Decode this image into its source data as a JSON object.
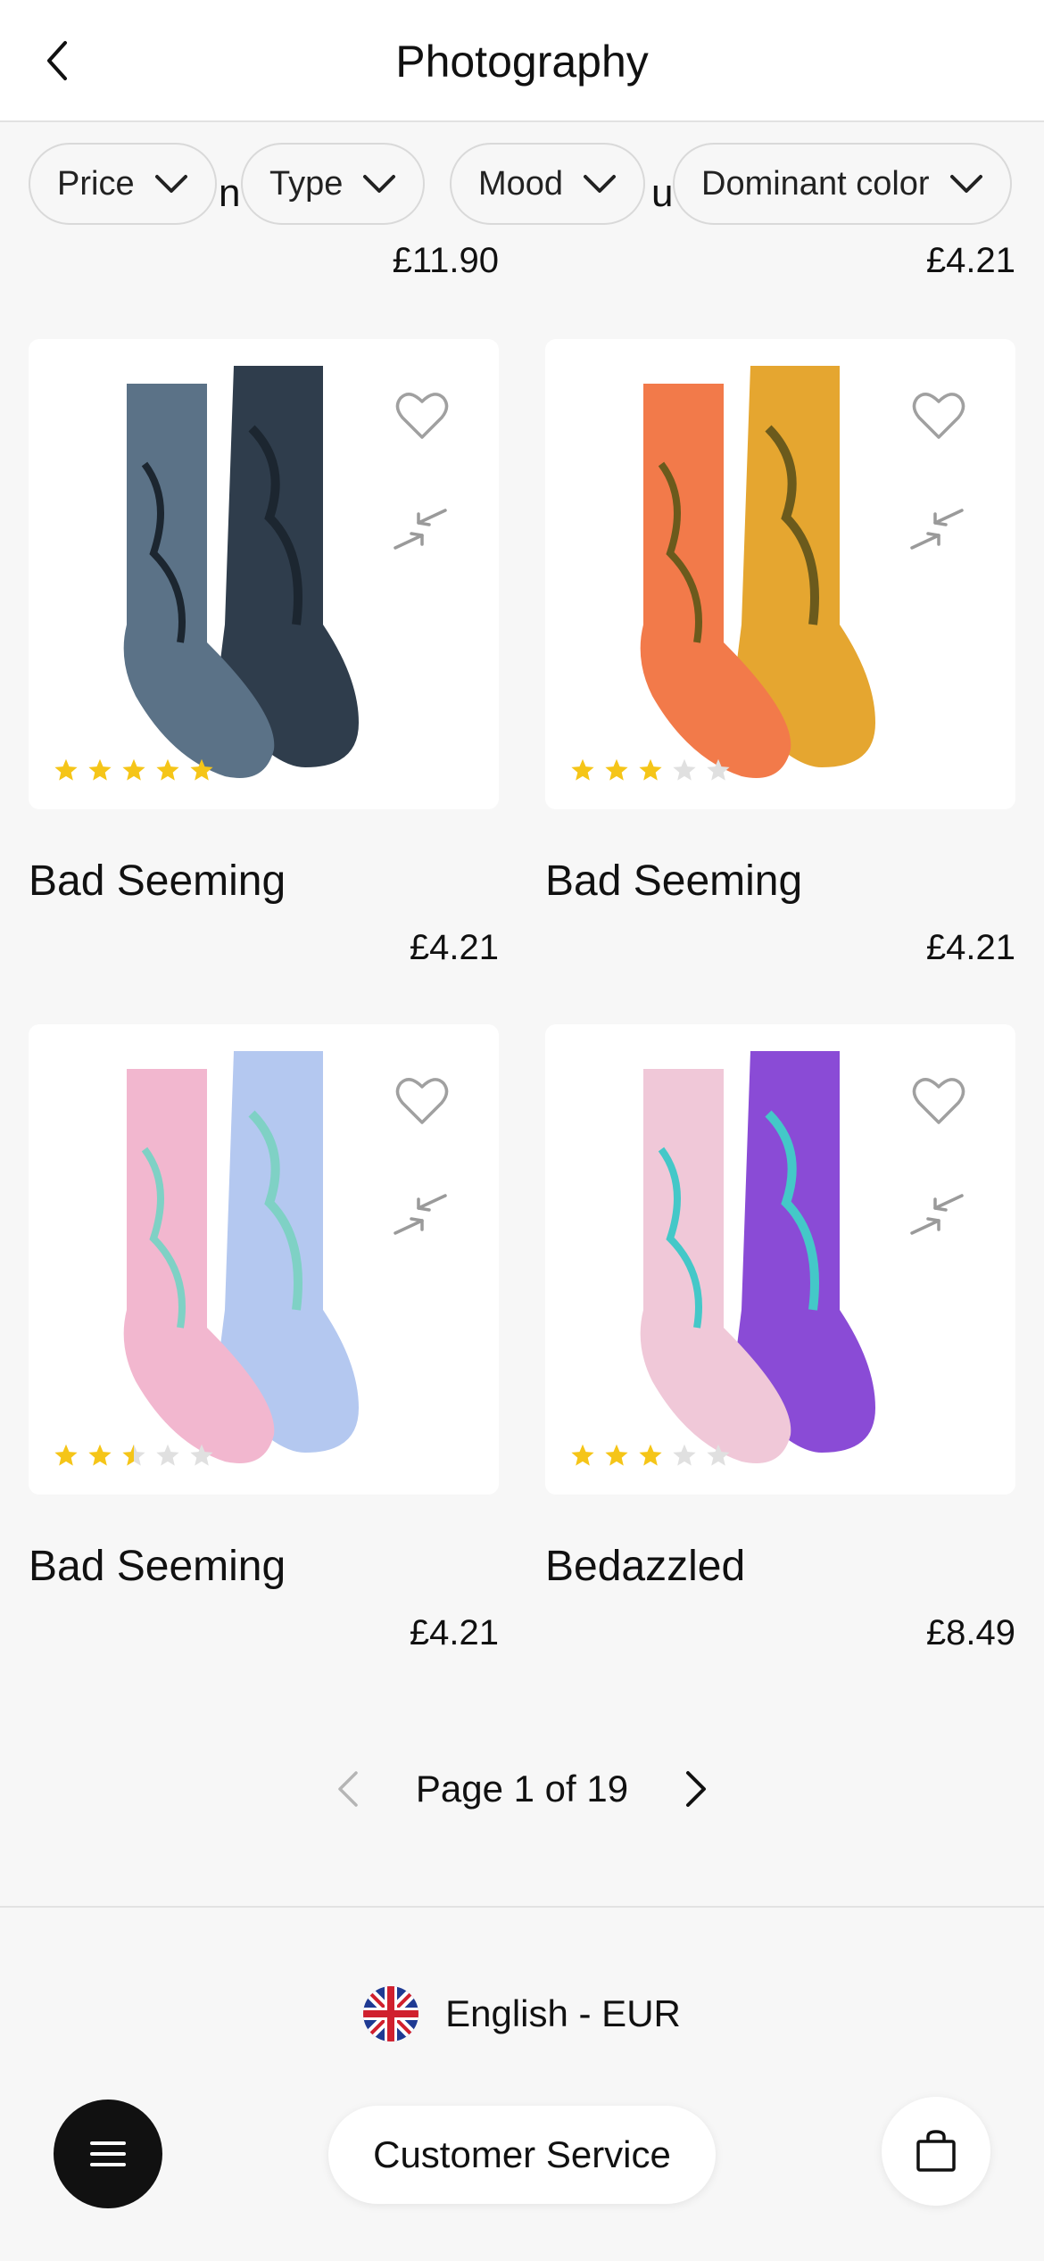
{
  "header": {
    "title": "Photography",
    "back_icon": "chevron-left-icon"
  },
  "filters": {
    "chips": [
      {
        "label": "Price",
        "icon": "chevron-down-icon"
      },
      {
        "label": "Type",
        "icon": "chevron-down-icon"
      },
      {
        "label": "Mood",
        "icon": "chevron-down-icon"
      },
      {
        "label": "Dominant color",
        "icon": "chevron-down-icon"
      }
    ],
    "partial_behind_left": "n",
    "partial_behind_right": "u"
  },
  "previous_row_prices": {
    "left": "£11.90",
    "right": "£4.21"
  },
  "products": [
    {
      "name": "Bad Seeming",
      "price": "£4.21",
      "rating": 5,
      "colors": [
        "#2f3d4c",
        "#5b7287",
        "#1c2630"
      ]
    },
    {
      "name": "Bad Seeming",
      "price": "£4.21",
      "rating": 3,
      "colors": [
        "#e5a630",
        "#f27a4a",
        "#6b5a1c"
      ]
    },
    {
      "name": "Bad Seeming",
      "price": "£4.21",
      "rating": 2.5,
      "colors": [
        "#b4c8f0",
        "#f2b7cf",
        "#7fd1c5"
      ]
    },
    {
      "name": "Bedazzled",
      "price": "£8.49",
      "rating": 3,
      "colors": [
        "#8a4bd6",
        "#f0c8d8",
        "#44c8c8"
      ]
    }
  ],
  "pagination": {
    "label": "Page 1 of 19",
    "prev_icon": "chevron-left-icon",
    "next_icon": "chevron-right-icon"
  },
  "footer": {
    "language_label": "English - EUR",
    "flag_icon": "uk-flag-icon",
    "customer_service_label": "Customer Service",
    "menu_icon": "hamburger-menu-icon",
    "bag_icon": "shopping-bag-icon"
  },
  "colors": {
    "star_filled": "#f5c518",
    "star_empty": "#e0e0e0",
    "icon_gray": "#9a9a9a"
  }
}
